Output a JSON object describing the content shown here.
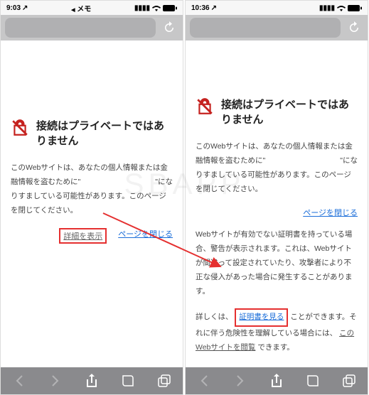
{
  "watermark": "SBAPP",
  "left": {
    "status": {
      "time": "9:03",
      "source": "メモ",
      "loc_arrow": "↗"
    },
    "heading": "接続はプライベートではありません",
    "body": "このWebサイトは、あなたの個人情報または金融情報を盗むために\"　　　　　　　　　　\"になりすましている可能性があります。このページを閉じてください。",
    "show_details": "詳細を表示",
    "close_page": "ページを閉じる"
  },
  "right": {
    "status": {
      "time": "10:36",
      "loc_arrow": "↗"
    },
    "heading": "接続はプライベートではありません",
    "body": "このWebサイトは、あなたの個人情報または金融情報を盗むために\"　　　　　　　　　　\"になりすましている可能性があります。このページを閉じてください。",
    "close_page": "ページを閉じる",
    "details_body": "Webサイトが有効でない証明書を持っている場合、警告が表示されます。これは、Webサイトが間違って設定されていたり、攻撃者により不正な侵入があった場合に発生することがあります。",
    "cert_pre": "詳しくは、",
    "cert_link": "証明書を見る",
    "cert_post": "ことができます。それに伴う危険性を理解している場合には、",
    "visit_link": "このWebサイトを閲覧",
    "visit_post": "できます。"
  }
}
